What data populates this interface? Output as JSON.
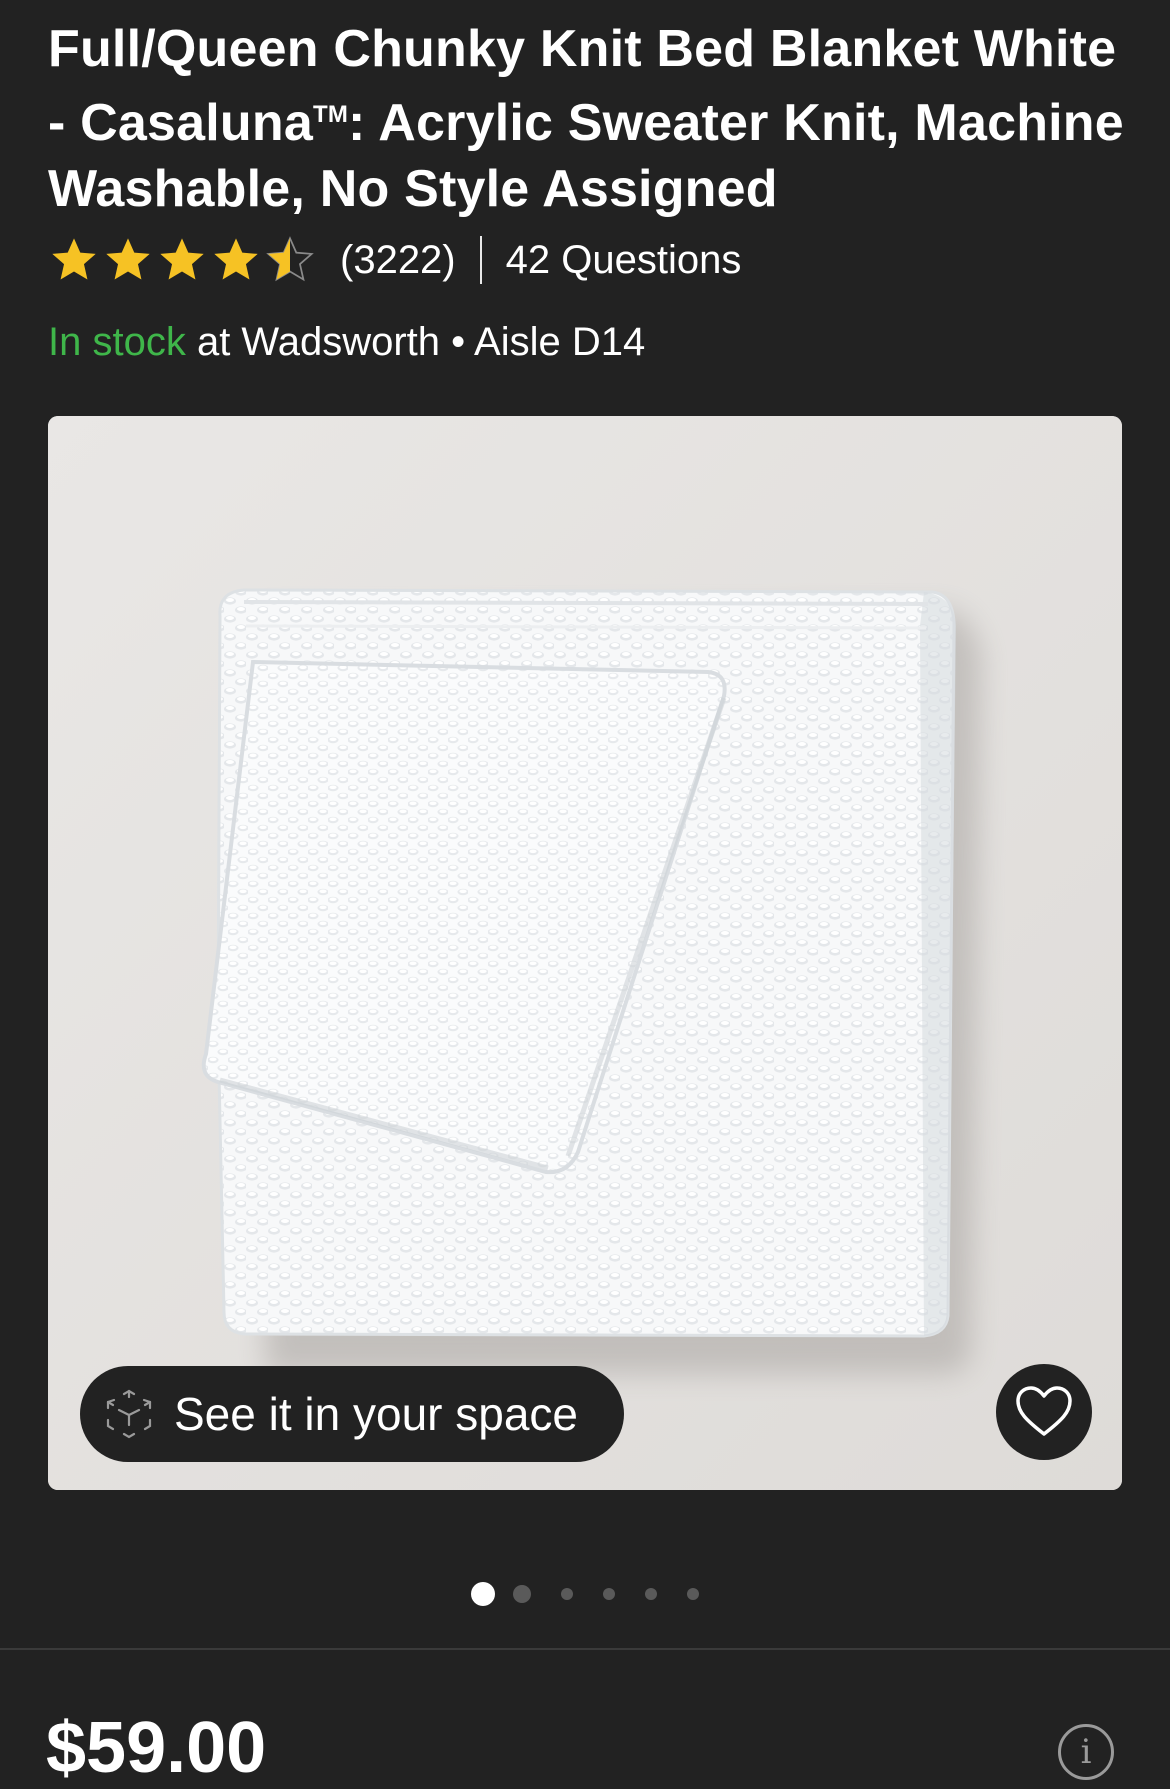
{
  "product": {
    "title_part1": "Full/Queen Chunky Knit Bed Blanket White - Casaluna",
    "trademark": "TM",
    "title_part2": ": Acrylic Sweater Knit, Machine Washable, No Style Assigned",
    "rating": 4.5,
    "rating_max": 5,
    "rating_count": "(3222)",
    "questions": "42 Questions",
    "stock_status": "In stock",
    "stock_location": " at Wadsworth • Aisle D14",
    "price": "$59.00"
  },
  "gallery": {
    "ar_button_label": "See it in your space",
    "image_count": 6,
    "active_index": 0
  },
  "colors": {
    "background": "#222222",
    "in_stock": "#3fb64a",
    "star": "#f6c224"
  },
  "icons": {
    "ar": "cube-ar-icon",
    "favorite": "heart-icon",
    "info": "info-icon",
    "star": "star-icon"
  }
}
